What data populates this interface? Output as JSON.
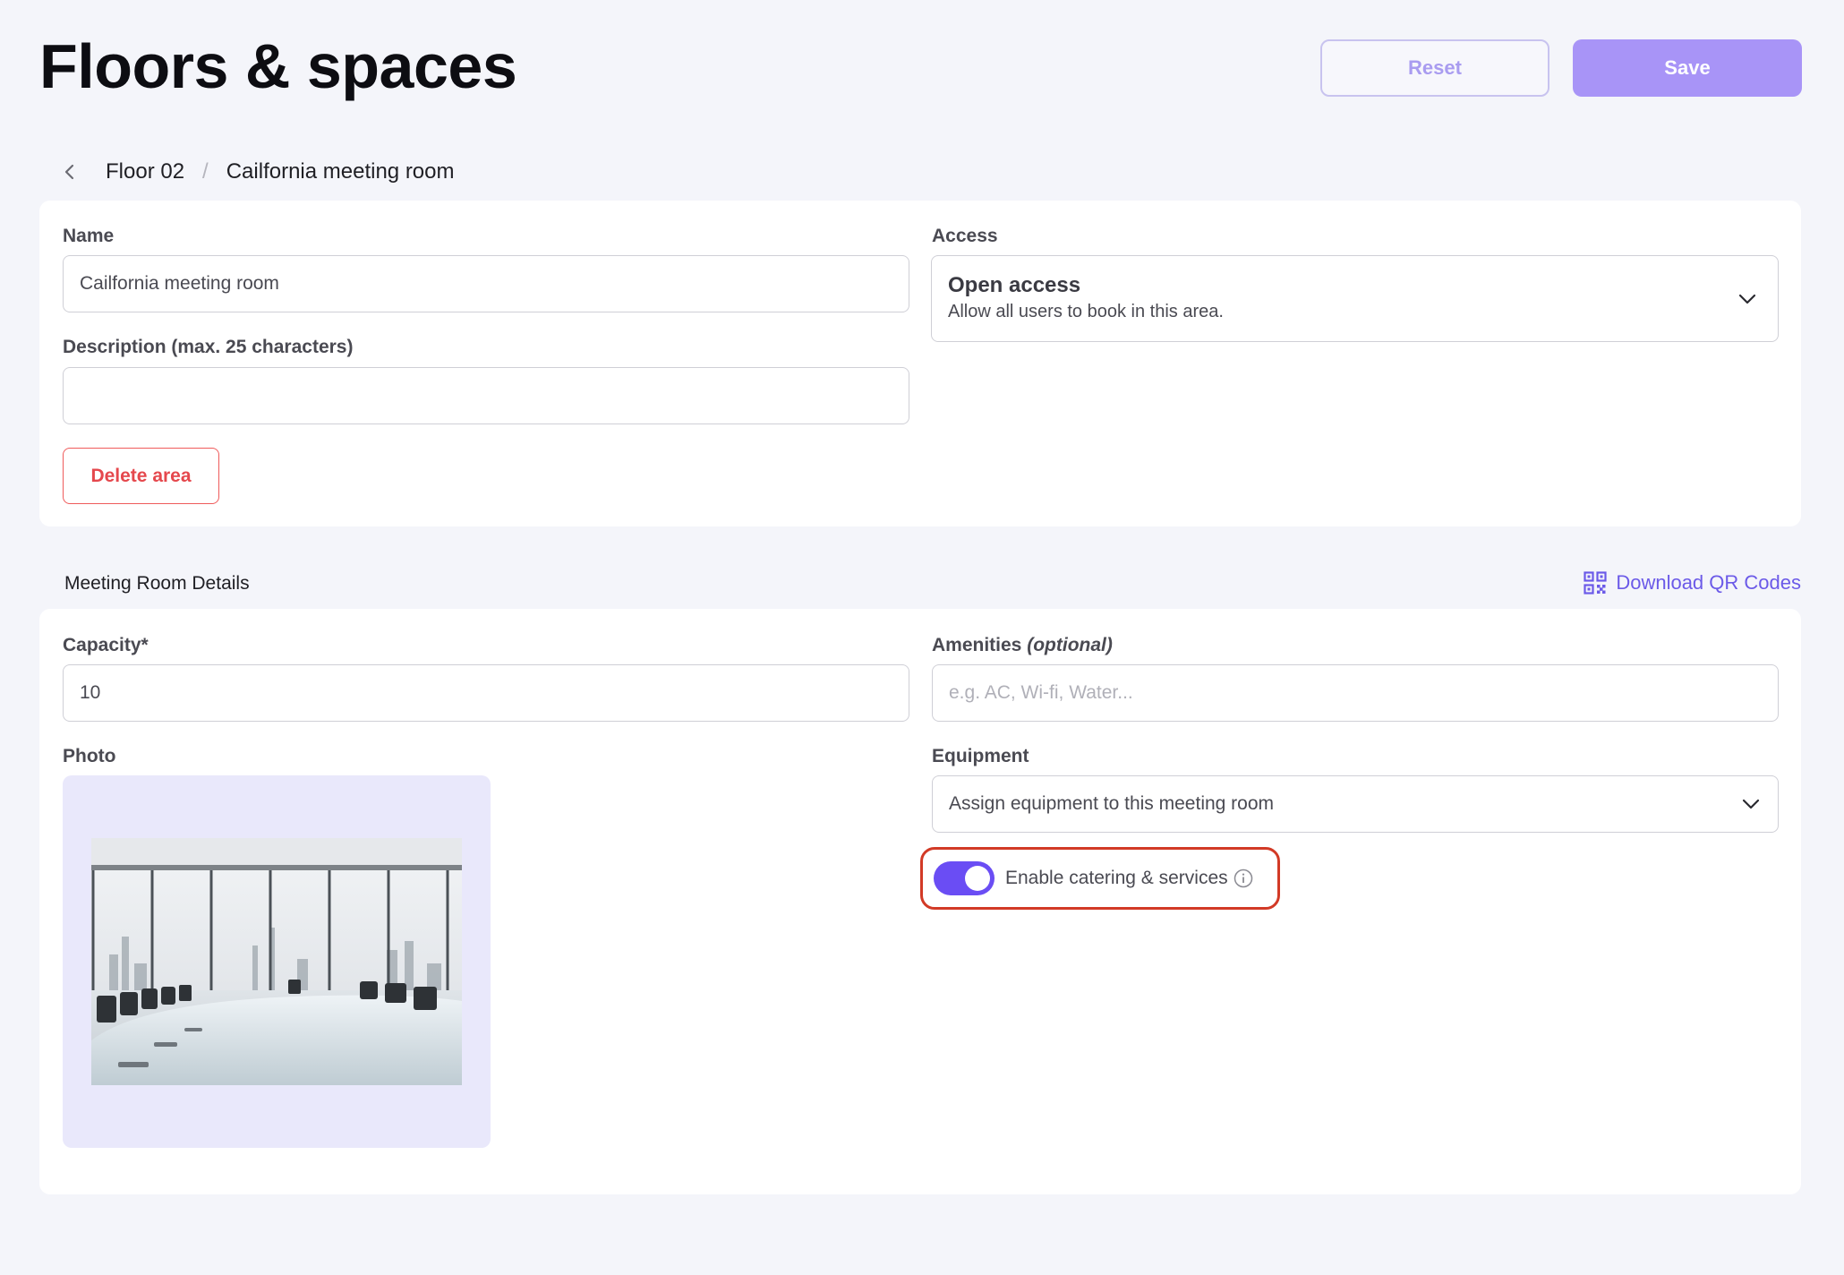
{
  "header": {
    "title": "Floors & spaces",
    "reset_label": "Reset",
    "save_label": "Save"
  },
  "breadcrumb": {
    "items": [
      "Floor 02",
      "Cailfornia meeting room"
    ],
    "separator": "/"
  },
  "area_form": {
    "name_label": "Name",
    "name_value": "Cailfornia meeting room",
    "description_label": "Description (max. 25 characters)",
    "description_value": "",
    "access_label": "Access",
    "access_title": "Open access",
    "access_subtitle": "Allow all users to book in this area.",
    "delete_label": "Delete area"
  },
  "details": {
    "section_title": "Meeting Room Details",
    "qr_label": "Download QR Codes",
    "capacity_label": "Capacity*",
    "capacity_value": "10",
    "amenities_label": "Amenities",
    "amenities_optional": "(optional)",
    "amenities_placeholder": "e.g. AC, Wi-fi, Water...",
    "photo_label": "Photo",
    "equipment_label": "Equipment",
    "equipment_value": "Assign equipment to this meeting room",
    "catering_label": "Enable catering & services",
    "catering_enabled": true
  },
  "colors": {
    "accent": "#6a4df4",
    "save_bg": "#a894f7",
    "danger": "#e5484d",
    "highlight": "#d23a26",
    "link": "#6b5ae8"
  },
  "icons": [
    "chevron-left-icon",
    "chevron-down-icon",
    "qr-code-icon",
    "info-icon"
  ]
}
